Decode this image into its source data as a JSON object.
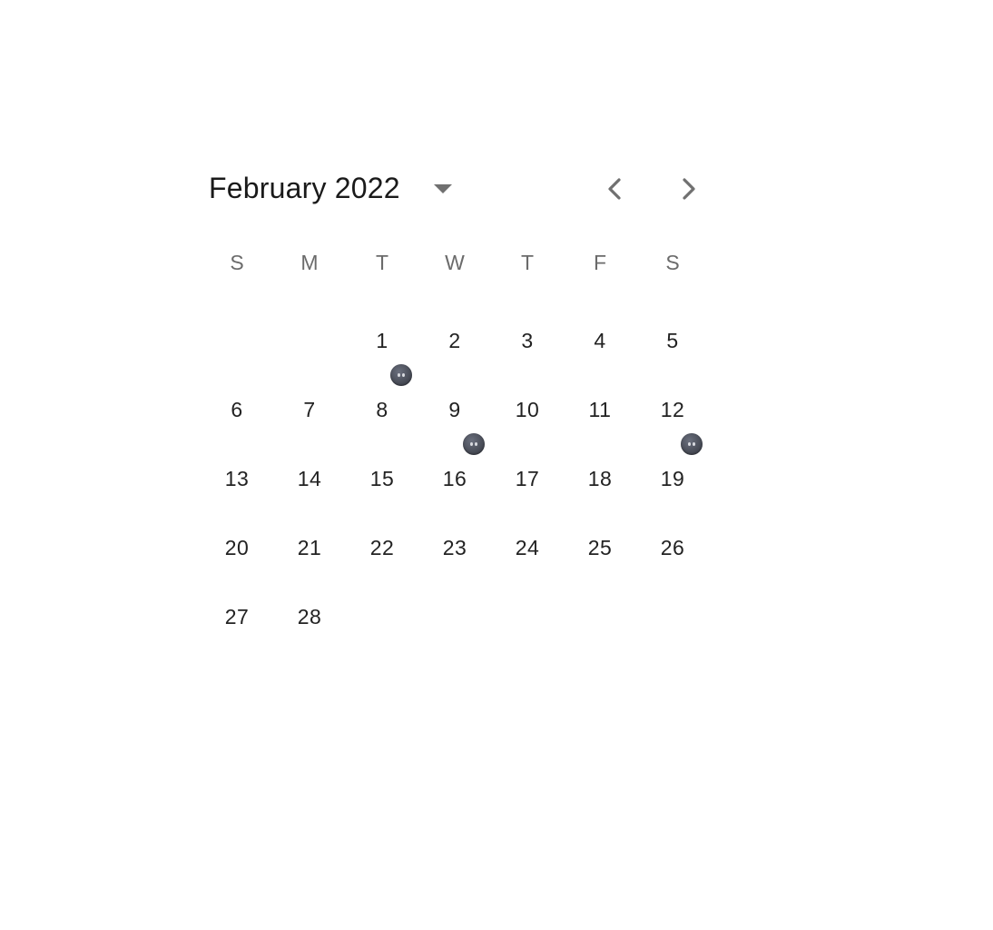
{
  "calendar": {
    "month_label": "February 2022",
    "weekdays": [
      "S",
      "M",
      "T",
      "W",
      "T",
      "F",
      "S"
    ],
    "weeks": [
      [
        "",
        "",
        "1",
        "2",
        "3",
        "4",
        "5"
      ],
      [
        "6",
        "7",
        "8",
        "9",
        "10",
        "11",
        "12"
      ],
      [
        "13",
        "14",
        "15",
        "16",
        "17",
        "18",
        "19"
      ],
      [
        "20",
        "21",
        "22",
        "23",
        "24",
        "25",
        "26"
      ],
      [
        "27",
        "28",
        "",
        "",
        "",
        "",
        ""
      ]
    ],
    "marked_days": [
      "8",
      "16",
      "19"
    ],
    "marker_icon": "new-moon-face-icon"
  },
  "icons": {
    "view_toggle": "caret-down-icon",
    "prev": "chevron-left-icon",
    "next": "chevron-right-icon"
  },
  "colors": {
    "text": "#222222",
    "weekday": "#6b6b6b",
    "icon": "#707070",
    "marker": "#4b4f5a"
  }
}
